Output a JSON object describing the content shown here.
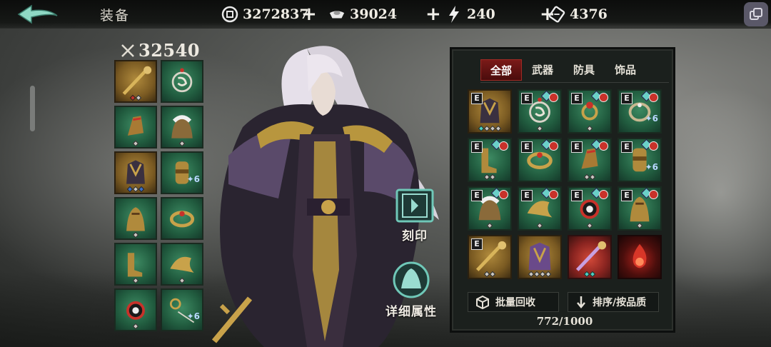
{
  "header": {
    "title": "装备",
    "back_icon": "back-arrow-icon",
    "resources": [
      {
        "name": "silver-coin",
        "icon": "coin-icon",
        "value": "3272837"
      },
      {
        "name": "ingot",
        "icon": "ingot-icon",
        "value": "39024"
      },
      {
        "name": "stamina",
        "icon": "lightning-icon",
        "value": "240"
      },
      {
        "name": "ticket",
        "icon": "ticket-icon",
        "value": "4376"
      }
    ],
    "plus_label": "+"
  },
  "equipped": {
    "power": "32540",
    "slots": [
      {
        "item": "staff",
        "frame": "gold",
        "gems": [
          "red",
          "gray"
        ]
      },
      {
        "item": "amulet",
        "frame": "green",
        "gems": []
      },
      {
        "item": "gauntlet",
        "frame": "green",
        "gems": [
          "gray"
        ]
      },
      {
        "item": "fur-cloak",
        "frame": "green",
        "gems": [
          "gray"
        ]
      },
      {
        "item": "armor",
        "frame": "gold",
        "gems": [
          "blue",
          "gray",
          "blue"
        ]
      },
      {
        "item": "bracer",
        "frame": "green",
        "gems": [],
        "count": "6"
      },
      {
        "item": "robe",
        "frame": "green",
        "gems": [
          "gray"
        ]
      },
      {
        "item": "bracelet",
        "frame": "green",
        "gems": []
      },
      {
        "item": "boots",
        "frame": "green",
        "gems": [
          "gray"
        ]
      },
      {
        "item": "shoulder",
        "frame": "green",
        "gems": [
          "gray"
        ]
      },
      {
        "item": "orb",
        "frame": "green",
        "gems": [
          "gray"
        ]
      },
      {
        "item": "ring-chain",
        "frame": "green",
        "gems": [],
        "count": "6"
      }
    ]
  },
  "actions": {
    "engrave_label": "刻印",
    "details_label": "详细属性"
  },
  "inventory": {
    "tabs": [
      "全部",
      "武器",
      "防具",
      "饰品"
    ],
    "active_tab": 0,
    "items": [
      {
        "item": "armor",
        "frame": "gold",
        "badge": "E",
        "gems": [
          "teal",
          "gray",
          "gray",
          "gray"
        ]
      },
      {
        "item": "amulet",
        "frame": "green",
        "badge": "E",
        "lock": true,
        "gems": [
          "gray"
        ]
      },
      {
        "item": "ring",
        "frame": "green",
        "badge": "E",
        "lock": true,
        "gems": [
          "gray"
        ]
      },
      {
        "item": "ring-bracelet",
        "frame": "green",
        "badge": "E",
        "lock": true,
        "count": "6",
        "gems": []
      },
      {
        "item": "boots",
        "frame": "green",
        "badge": "E",
        "lock": true,
        "gems": [
          "gray",
          "gray"
        ]
      },
      {
        "item": "bracelet",
        "frame": "green",
        "badge": "E",
        "lock": true,
        "gems": []
      },
      {
        "item": "gauntlet",
        "frame": "green",
        "badge": "E",
        "lock": true,
        "gems": [
          "gray",
          "gray"
        ]
      },
      {
        "item": "bracer",
        "frame": "green",
        "badge": "E",
        "lock": true,
        "count": "6",
        "gems": []
      },
      {
        "item": "fur-cloak",
        "frame": "green",
        "badge": "E",
        "lock": true,
        "gems": [
          "gray"
        ]
      },
      {
        "item": "shoulder",
        "frame": "green",
        "badge": "E",
        "lock": true,
        "gems": [
          "gray"
        ]
      },
      {
        "item": "orb",
        "frame": "green",
        "badge": "E",
        "lock": true,
        "gems": [
          "gray"
        ]
      },
      {
        "item": "robe",
        "frame": "green",
        "badge": "E",
        "lock": true,
        "gems": [
          "gray"
        ]
      },
      {
        "item": "staff",
        "frame": "gold",
        "badge": "E",
        "gems": [
          "gray",
          "gray"
        ]
      },
      {
        "item": "purple-armor",
        "frame": "gold",
        "badge": "",
        "gems": [
          "gray",
          "gray",
          "gray",
          "gray"
        ]
      },
      {
        "item": "red-staff",
        "frame": "red",
        "badge": "",
        "gems": [
          "teal",
          "teal"
        ]
      },
      {
        "item": "flame",
        "frame": "dark",
        "badge": "",
        "gems": []
      }
    ],
    "bulk_recycle_label": "批量回收",
    "sort_label": "排序/按品质",
    "capacity": "772/1000"
  }
}
